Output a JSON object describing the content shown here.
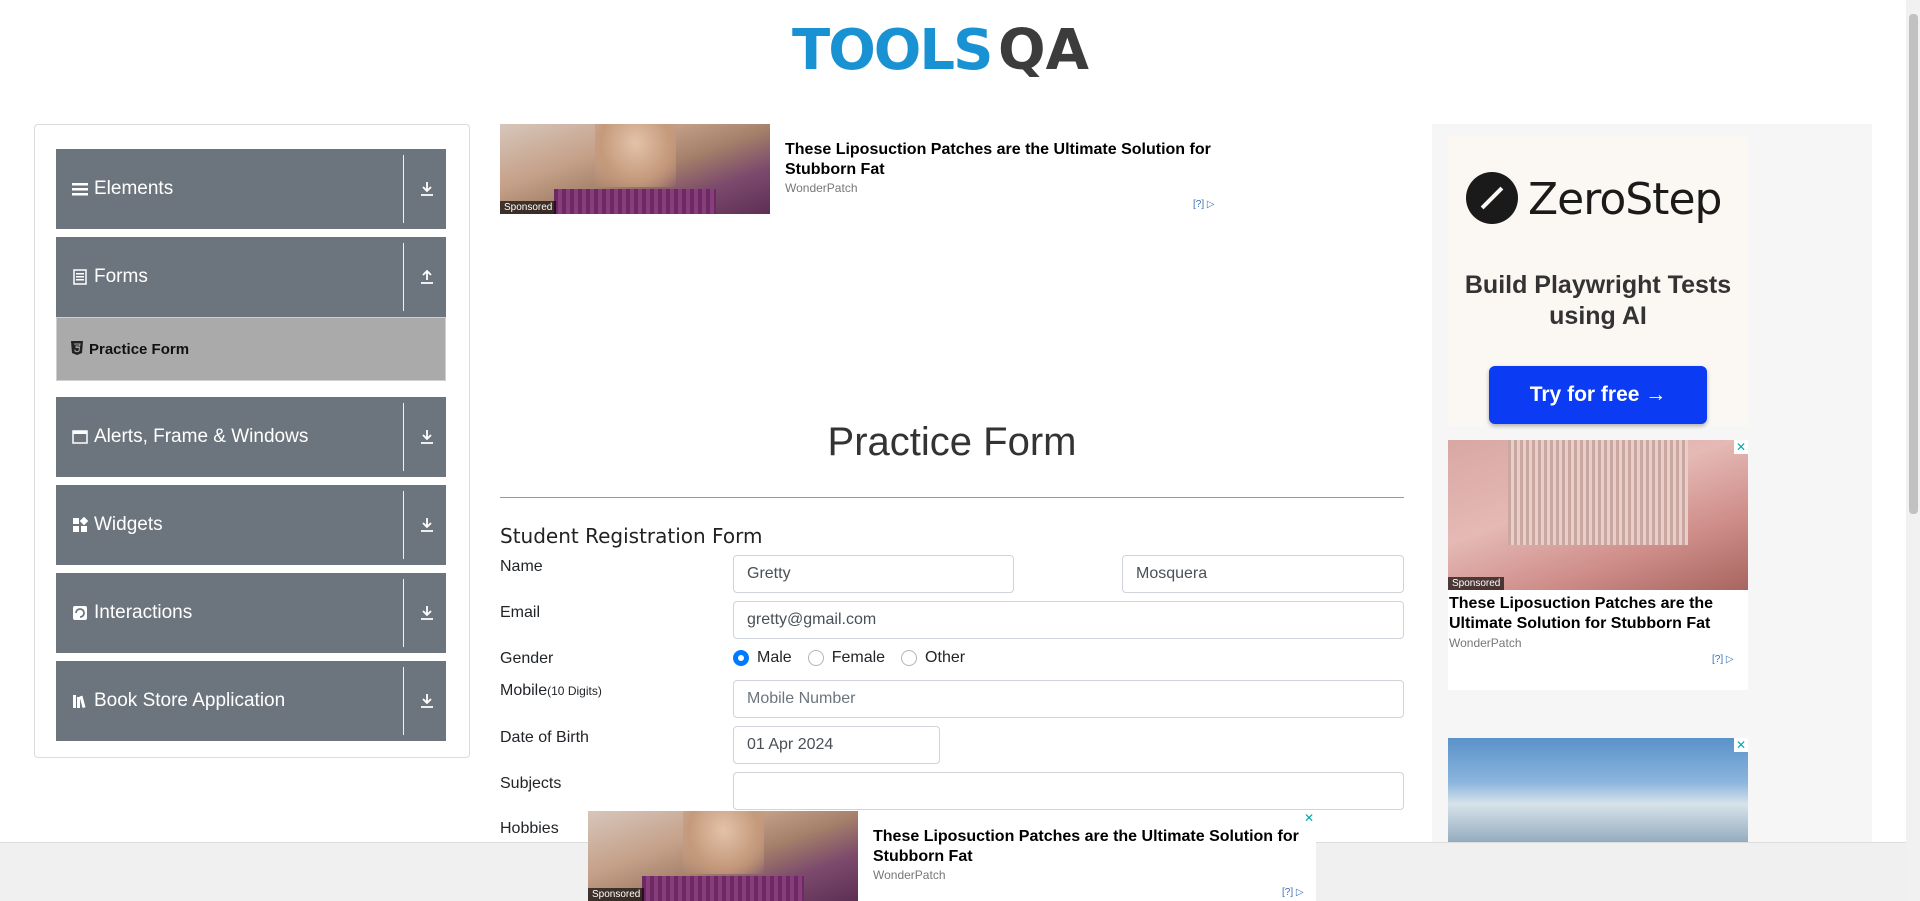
{
  "header": {
    "logo_text": "TOOLS",
    "logo_qa": "QA"
  },
  "sidebar": {
    "groups": [
      {
        "label": "Elements",
        "icon": "menu-icon",
        "arrow": "download-arrow-icon"
      },
      {
        "label": "Forms",
        "icon": "form-icon",
        "arrow": "upload-arrow-icon"
      },
      {
        "label": "Alerts, Frame & Windows",
        "icon": "window-icon",
        "arrow": "download-arrow-icon"
      },
      {
        "label": "Widgets",
        "icon": "widgets-icon",
        "arrow": "download-arrow-icon"
      },
      {
        "label": "Interactions",
        "icon": "interactions-icon",
        "arrow": "download-arrow-icon"
      },
      {
        "label": "Book Store Application",
        "icon": "books-icon",
        "arrow": "download-arrow-icon"
      }
    ],
    "active_item": "Practice Form"
  },
  "ads": {
    "top": {
      "title": "These Liposuction Patches are the Ultimate Solution for Stubborn Fat",
      "source": "WonderPatch",
      "sponsored": "Sponsored",
      "adchoice": "[?]"
    },
    "zerostep": {
      "name": "ZeroStep",
      "tagline": "Build Playwright Tests using AI",
      "button": "Try for free →"
    },
    "right": {
      "title": "These Liposuction Patches are the Ultimate Solution for Stubborn Fat",
      "source": "WonderPatch",
      "sponsored": "Sponsored",
      "adchoice": "[?]"
    },
    "bottom": {
      "title": "These Liposuction Patches are the Ultimate Solution for Stubborn Fat",
      "source": "WonderPatch",
      "sponsored": "Sponsored",
      "adchoice": "[?]"
    }
  },
  "form": {
    "page_title": "Practice Form",
    "title": "Student Registration Form",
    "labels": {
      "name": "Name",
      "email": "Email",
      "gender": "Gender",
      "mobile": "Mobile",
      "mobile_hint": "(10 Digits)",
      "dob": "Date of Birth",
      "subjects": "Subjects",
      "hobbies": "Hobbies"
    },
    "first_name": "Gretty",
    "last_name": "Mosquera",
    "email": "gretty@gmail.com",
    "gender_options": [
      "Male",
      "Female",
      "Other"
    ],
    "gender_selected": "Male",
    "mobile_placeholder": "Mobile Number",
    "dob": "01 Apr 2024",
    "subjects": ""
  },
  "colors": {
    "accent": "#007bff",
    "sidebar_group": "#6c757d",
    "sidebar_active": "#aaaaaa",
    "logo_blue": "#1992d4",
    "zerostep_button": "#0b3bf2"
  }
}
